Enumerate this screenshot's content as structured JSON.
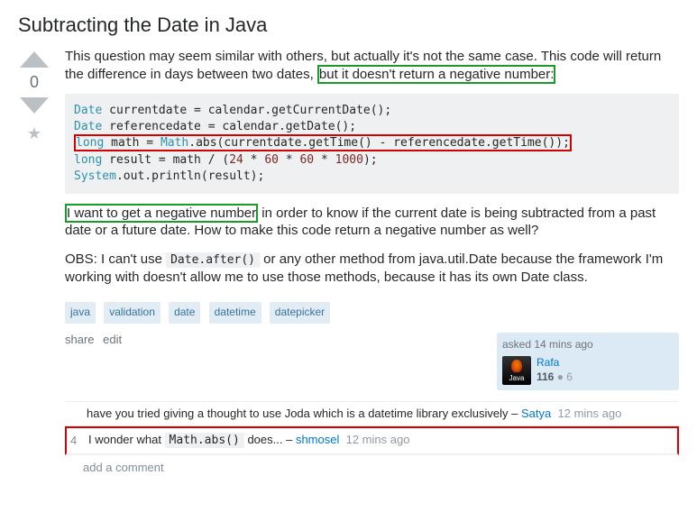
{
  "question": {
    "title": "Subtracting the Date in Java",
    "score": "0",
    "body": {
      "p1_a": "This question may seem similar with others, but actually it's not the same case. This code will return the difference in days between two dates, ",
      "p1_hl": "but it doesn't return a negative number:",
      "code": {
        "l1_a": "Date",
        "l1_b": " currentdate = calendar.getCurrentDate();",
        "l2_a": "Date",
        "l2_b": " referencedate = calendar.getDate();",
        "l3_a": "long",
        "l3_b": " math = ",
        "l3_c": "Math",
        "l3_d": ".abs(currentdate.getTime() - referencedate.getTime());",
        "l4_a": "long",
        "l4_b": " result = math / (",
        "l4_c": "24",
        "l4_d": " * ",
        "l4_e": "60",
        "l4_f": " * ",
        "l4_g": "60",
        "l4_h": " * ",
        "l4_i": "1000",
        "l4_j": ");",
        "l5_a": "System",
        "l5_b": ".out.println(result);"
      },
      "p2_hl": "I want to get a negative number",
      "p2_a": " in order to know if the current date is being subtracted from a past date or a future date. How to make this code return a negative number as well?",
      "p3_a": "OBS: I can't use ",
      "p3_code": "Date.after()",
      "p3_b": " or any other method from java.util.Date because the framework I'm working with doesn't allow me to use those methods, because it has its own Date class."
    },
    "tags": [
      "java",
      "validation",
      "date",
      "datetime",
      "datepicker"
    ],
    "menu": {
      "share": "share",
      "edit": "edit"
    },
    "user": {
      "asked": "asked 14 mins ago",
      "name": "Rafa",
      "rep": "116",
      "badges": "● 6"
    }
  },
  "comments": [
    {
      "score": "",
      "text": "have you tried giving a thought to use Joda which is a datetime library exclusively",
      "user": "Satya",
      "time": "12 mins ago",
      "highlight": false
    },
    {
      "score": "4",
      "text_a": "I wonder what ",
      "code": "Math.abs()",
      "text_b": " does...",
      "user": "shmosel",
      "time": "12 mins ago",
      "highlight": true
    }
  ],
  "add_comment": "add a comment"
}
